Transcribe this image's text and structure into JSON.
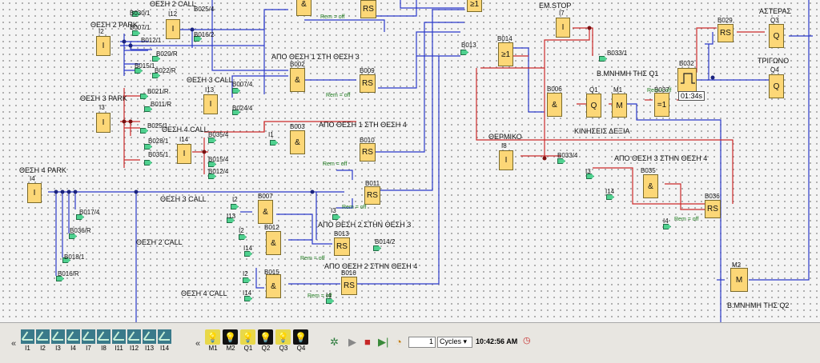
{
  "labels": {
    "l_thesi2call": "ΘΕΣΗ 2 CALL",
    "l_thesi2park": "ΘΕΣΗ 2 PARK",
    "l_thesi3park": "ΘΕΣΗ 3 PARK",
    "l_thesi4park": "ΘΕΣΗ 4 PARK",
    "l_thesi3call_a": "ΘΕΣΗ 3 CALL",
    "l_thesi4call_a": "ΘΕΣΗ 4 CALL",
    "l_thesi3call_b": "ΘΕΣΗ 3 CALL",
    "l_thesi2call_b": "ΘΕΣΗ 2 CALL",
    "l_thesi4call_b": "ΘΕΣΗ 4 CALL",
    "l_apo1sto3": "ΑΠΟ ΘΕΣΗ 1 ΣΤΗ ΘΕΣΗ 3",
    "l_apo1sto4": "ΑΠΟ ΘΕΣΗ 1 ΣΤΗ ΘΕΣΗ 4",
    "l_apo2sto3": "ΑΠΟ ΘΕΣΗ 2 ΣΤΗΝ ΘΕΣΗ 3",
    "l_apo2sto4": "ΑΠΟ ΘΕΣΗ 2 ΣΤΗΝ ΘΕΣΗ 4",
    "l_apo3sto4": "ΑΠΟ ΘΕΣΗ 3 ΣΤΗΝ ΘΕΣΗ 4",
    "l_emstop": "EM.STOP",
    "l_thermiko": "ΘΕΡΜΙΚΟ",
    "l_kiniseis": "ΚΙΝΗΣΕΙΣ ΔΕΞΙΑ",
    "l_mnimi_q1": "Β.ΜΝΗΜΗ ΤΗΣ Q1",
    "l_mnimi_q2": "Β.ΜΝΗΜΗ ΤΗΣ Q2",
    "l_asteras": "ΑΣΤΕΡΑΣ",
    "l_trigono": "ΤΡΙΓΩΝΟ"
  },
  "blocks": {
    "i12": {
      "name": "I12",
      "sym": "I"
    },
    "i2": {
      "name": "I2",
      "sym": "I"
    },
    "i3": {
      "name": "I3",
      "sym": "I"
    },
    "i13": {
      "name": "I13",
      "sym": "I"
    },
    "i14": {
      "name": "I14",
      "sym": "I"
    },
    "i4": {
      "name": "I4",
      "sym": "I"
    },
    "i7": {
      "name": "I7",
      "sym": "I"
    },
    "i8": {
      "name": "I8",
      "sym": "I"
    },
    "b002": {
      "name": "B002",
      "sym": "&"
    },
    "b003": {
      "name": "B003",
      "sym": "&"
    },
    "b007": {
      "name": "B007",
      "sym": "&"
    },
    "b012": {
      "name": "B012",
      "sym": "&"
    },
    "b015": {
      "name": "B015",
      "sym": "&"
    },
    "b006": {
      "name": "B006",
      "sym": "&"
    },
    "b035": {
      "name": "B035",
      "sym": "&"
    },
    "b009": {
      "name": "B009",
      "sym": "RS"
    },
    "b010": {
      "name": "B010",
      "sym": "RS"
    },
    "b011": {
      "name": "B011",
      "sym": "RS"
    },
    "b013": {
      "name": "B013",
      "sym": "RS"
    },
    "b016": {
      "name": "B016",
      "sym": "RS"
    },
    "b029": {
      "name": "B029",
      "sym": "RS"
    },
    "b036": {
      "name": "B036",
      "sym": "RS"
    },
    "btop": {
      "name": "",
      "sym": "RS"
    },
    "b014": {
      "name": "B014",
      "sym": "≥1"
    },
    "b037": {
      "name": "B037",
      "sym": "=1"
    },
    "q1": {
      "name": "Q1",
      "sym": "Q"
    },
    "q3": {
      "name": "Q3",
      "sym": "Q"
    },
    "q4": {
      "name": "Q4",
      "sym": "Q"
    },
    "m1": {
      "name": "M1",
      "sym": "M"
    },
    "m2": {
      "name": "M2",
      "sym": "M"
    },
    "b032": {
      "name": "B032"
    },
    "timer_value": "01:34s"
  },
  "pins": {
    "b030": "B030/1",
    "b007_1": "B007/1",
    "b012_1": "B012/1",
    "b020": "B020/R",
    "b015_1": "B015/1",
    "b022": "B022/R",
    "b025": "B025/4",
    "b016_2": "B016/2",
    "b021": "B021/R",
    "b011_1": "B011/R",
    "b025_1": "B025/1",
    "b028": "B028/1",
    "b035_1": "B035/1",
    "b007_4": "B007/4",
    "b024": "B024/4",
    "b035_4": "B035/4",
    "b015_4": "B015/4",
    "b012_4": "B012/4",
    "b017": "B017/4",
    "b036_r": "B036/R",
    "b018": "B018/1",
    "b016_r": "B016/R",
    "b014_2": "B014/2",
    "b013_pin": "B013",
    "b033_1": "B033/1",
    "b033_4": "B033/4",
    "i1": "I1",
    "i2a": "I2",
    "i13a": "I13",
    "i2b": "I2",
    "i14a": "I14",
    "i2c": "I2",
    "i14b": "I14",
    "i3a": "I3",
    "i14c": "I14",
    "i4a": "I4",
    "i3b": "I3",
    "i4b": "I4"
  },
  "rem": "Rem = off",
  "toolbar": {
    "inputs": [
      "I1",
      "I2",
      "I3",
      "I4",
      "I7",
      "I8",
      "I11",
      "I12",
      "I13",
      "I14"
    ],
    "outputs": [
      "M1",
      "M2",
      "Q1",
      "Q2",
      "Q3",
      "Q4"
    ],
    "outputs_on": [
      true,
      false,
      true,
      false,
      true,
      false
    ],
    "cycles_value": "1",
    "cycles_unit": "Cycles",
    "clock": "10:42:56 AM"
  },
  "colors": {
    "block": "#fcd777",
    "wire_blue": "#2233cc",
    "wire_red": "#cc2222"
  }
}
